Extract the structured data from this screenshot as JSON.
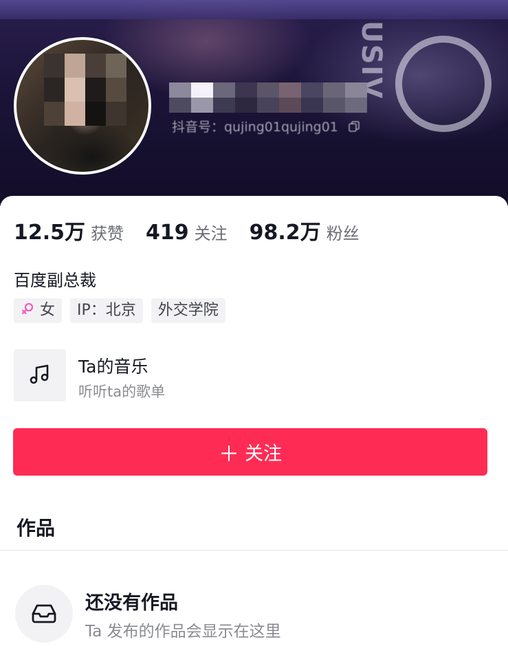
{
  "profile": {
    "douyin_id": "抖音号：qujing01qujing01",
    "stats": [
      {
        "value": "12.5万",
        "label": "获赞"
      },
      {
        "value": "419",
        "label": "关注"
      },
      {
        "value": "98.2万",
        "label": "粉丝"
      }
    ],
    "bio": "百度副总裁",
    "tags": {
      "gender": "女",
      "ip": "IP：北京",
      "school": "外交学院"
    },
    "gender_color": "#f25bc0"
  },
  "music": {
    "title": "Ta的音乐",
    "subtitle": "听听ta的歌单",
    "icon": "music-note-icon"
  },
  "follow": {
    "label": "关注",
    "icon": "plus-icon",
    "color": "#fe2c55"
  },
  "works": {
    "section_title": "作品",
    "empty_title": "还没有作品",
    "empty_subtitle": "Ta 发布的作品会显示在这里",
    "empty_icon": "inbox-tray-icon"
  }
}
